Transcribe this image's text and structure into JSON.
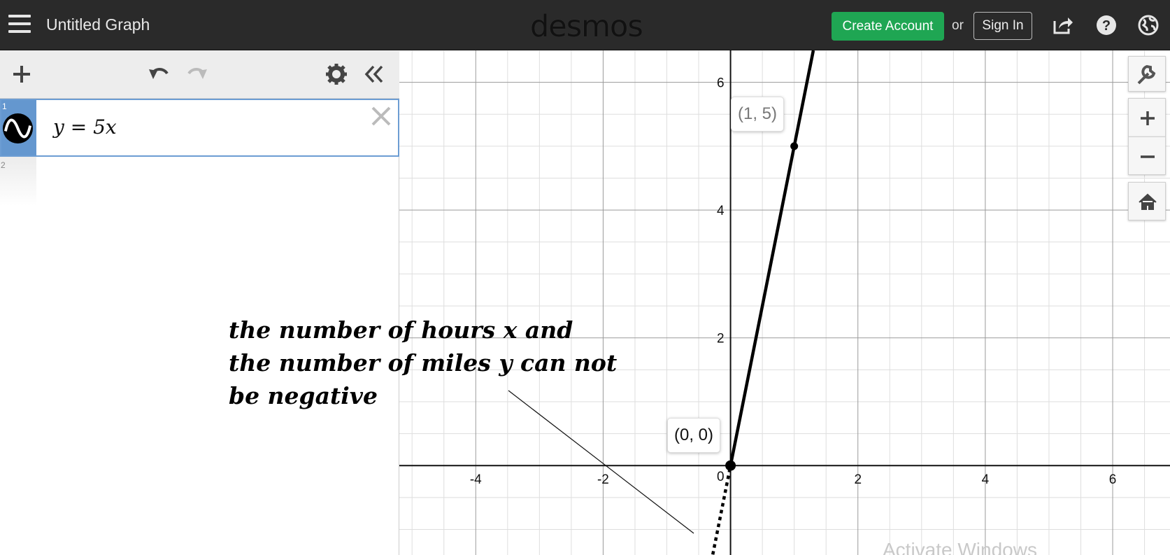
{
  "header": {
    "title": "Untitled Graph",
    "logo": "desmos",
    "create_account_label": "Create Account",
    "or_text": "or",
    "sign_in_label": "Sign In",
    "accent_color": "#1fa653"
  },
  "expressions": [
    {
      "index": "1",
      "latex": "y = 5x"
    },
    {
      "index": "2",
      "latex": ""
    }
  ],
  "graph": {
    "x_ticks": [
      "-4",
      "-2",
      "2",
      "4",
      "6"
    ],
    "y_ticks": [
      "6",
      "4",
      "2"
    ],
    "origin_label": "0",
    "point_labels": [
      "(1, 5)",
      "(0, 0)"
    ]
  },
  "chart_data": {
    "type": "line",
    "series": [
      {
        "name": "y = 5x",
        "x": [
          -0.3,
          1.3
        ],
        "y": [
          -1.5,
          6.5
        ]
      }
    ],
    "points": [
      {
        "label": "(1, 5)",
        "x": 1,
        "y": 5
      },
      {
        "label": "(0, 0)",
        "x": 0,
        "y": 0
      }
    ],
    "xlim": [
      -5.2,
      6.9
    ],
    "ylim": [
      -1.4,
      6.5
    ],
    "grid": true
  },
  "annotation": "the number of hours x and the number of miles y can not be negative",
  "watermark": "Activate Windows"
}
